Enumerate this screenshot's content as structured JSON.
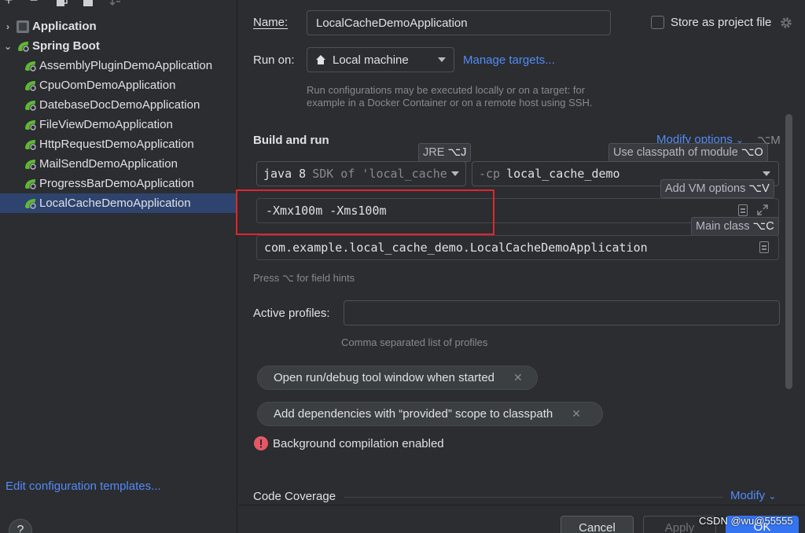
{
  "sidebar": {
    "toolbar": {
      "add": "+",
      "remove": "−"
    },
    "groups": [
      {
        "label": "Application",
        "expanded": false
      },
      {
        "label": "Spring Boot",
        "expanded": true
      }
    ],
    "items": [
      {
        "label": "AssemblyPluginDemoApplication"
      },
      {
        "label": "CpuOomDemoApplication"
      },
      {
        "label": "DatebaseDocDemoApplication"
      },
      {
        "label": "FileViewDemoApplication"
      },
      {
        "label": "HttpRequestDemoApplication"
      },
      {
        "label": "MailSendDemoApplication"
      },
      {
        "label": "ProgressBarDemoApplication"
      },
      {
        "label": "LocalCacheDemoApplication",
        "selected": true
      }
    ],
    "edit_templates": "Edit configuration templates...",
    "help": "?"
  },
  "main": {
    "name_label": "Name:",
    "name_value": "LocalCacheDemoApplication",
    "store_as_project": "Store as project file",
    "run_on_label": "Run on:",
    "run_on_value": "Local machine",
    "manage_targets": "Manage targets...",
    "run_on_hint_1": "Run configurations may be executed locally or on a target: for",
    "run_on_hint_2": "example in a Docker Container or on a remote host using SSH.",
    "build_and_run": "Build and run",
    "modify_options": "Modify options",
    "modify_options_shortcut": "⌥M",
    "jre_tooltip": "JRE",
    "jre_key": "⌥J",
    "classpath_tooltip": "Use classpath of module",
    "classpath_key": "⌥O",
    "vm_tooltip": "Add VM options",
    "vm_key": "⌥V",
    "main_class_tooltip": "Main class",
    "main_class_key": "⌥C",
    "sdk_bold": "java 8",
    "sdk_rest": "SDK of 'local_cache",
    "cp_flag": "-cp",
    "cp_module": "local_cache_demo",
    "vm_options": "-Xmx100m -Xms100m",
    "main_class": "com.example.local_cache_demo.LocalCacheDemoApplication",
    "field_hints": "Press ⌥ for field hints",
    "active_profiles_label": "Active profiles:",
    "active_profiles_value": "",
    "profiles_hint": "Comma separated list of profiles",
    "pill_1": "Open run/debug tool window when started",
    "pill_2": "Add dependencies with “provided” scope to classpath",
    "bg_compilation": "Background compilation enabled",
    "code_coverage": "Code Coverage",
    "modify": "Modify",
    "cancel": "Cancel",
    "apply": "Apply",
    "ok": "OK",
    "watermark": "CSDN @wu@55555"
  },
  "colors": {
    "accent_link": "#548af7",
    "selection": "#2e436e",
    "highlight_box": "#e0262d",
    "ok_button": "#3574f0",
    "error_icon": "#e55765",
    "spring_green": "#5fb832"
  }
}
